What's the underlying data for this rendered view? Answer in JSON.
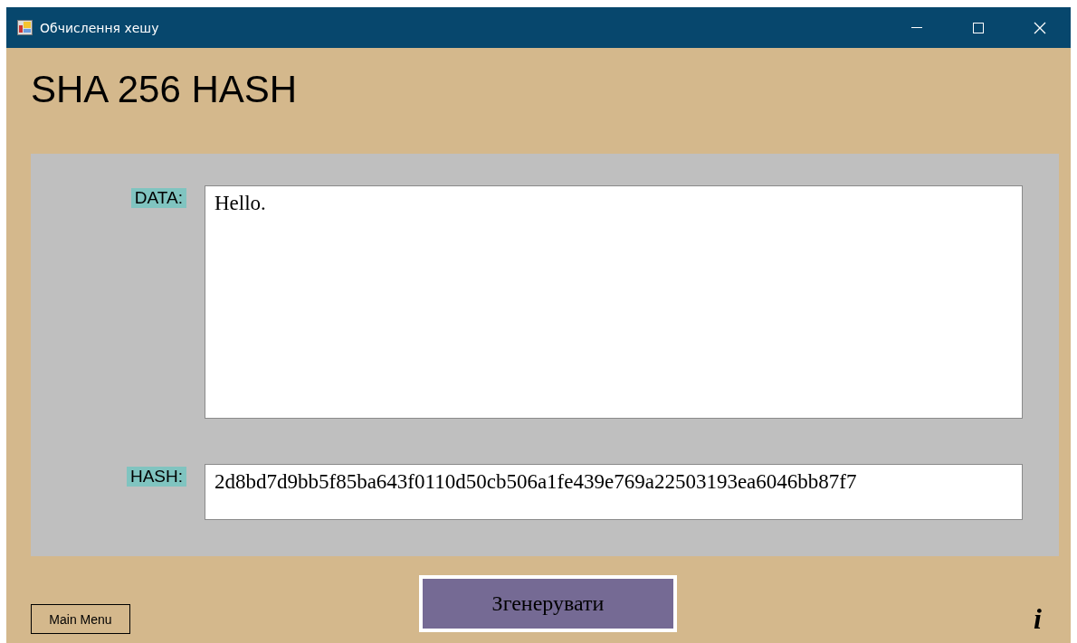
{
  "window": {
    "title": "Обчислення хешу"
  },
  "heading": "SHA 256 HASH",
  "data_field": {
    "label": "DATA:",
    "value": "Hello."
  },
  "hash_field": {
    "label": "HASH:",
    "value": "2d8bd7d9bb5f85ba643f0110d50cb506a1fe439e769a22503193ea6046bb87f7"
  },
  "generate_button": "Згенерувати",
  "main_menu_button": "Main Menu",
  "info_button": "i"
}
